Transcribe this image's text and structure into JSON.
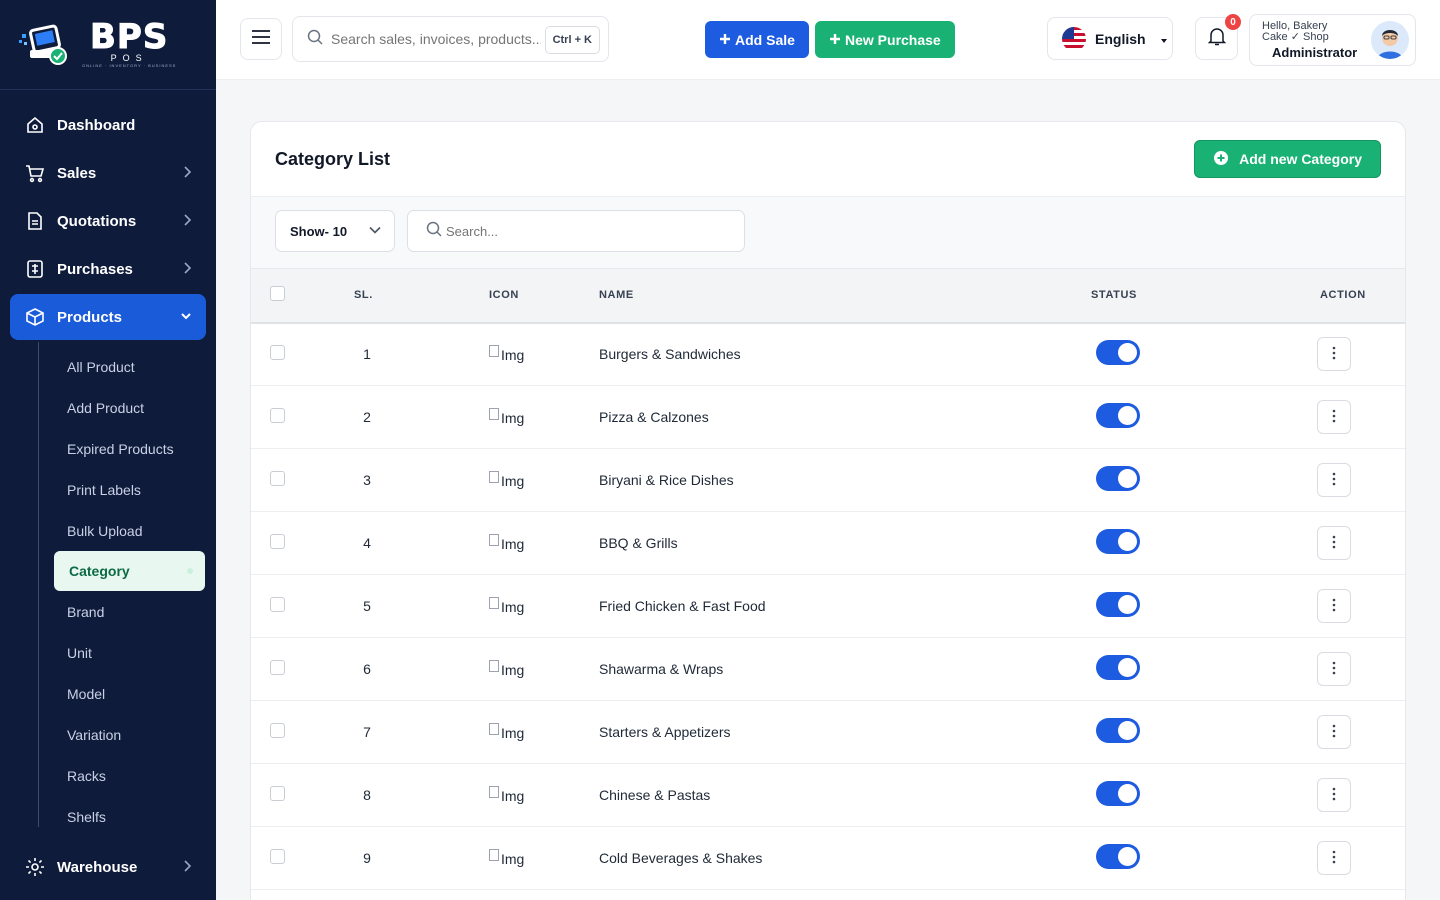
{
  "brand": {
    "name": "BPS",
    "sub": "POS",
    "tagline": "ONLINE · INVENTORY · BUSINESS"
  },
  "sidebar": {
    "items": [
      {
        "label": "Dashboard",
        "icon": "home-icon",
        "has_chevron": false
      },
      {
        "label": "Sales",
        "icon": "cart-icon",
        "has_chevron": true
      },
      {
        "label": "Quotations",
        "icon": "document-icon",
        "has_chevron": true
      },
      {
        "label": "Purchases",
        "icon": "receipt-icon",
        "has_chevron": true
      },
      {
        "label": "Products",
        "icon": "box-icon",
        "has_chevron": true,
        "active": true
      },
      {
        "label": "Warehouse",
        "icon": "gear-icon",
        "has_chevron": true
      }
    ],
    "products_sub": [
      "All Product",
      "Add Product",
      "Expired Products",
      "Print Labels",
      "Bulk Upload",
      "Category",
      "Brand",
      "Unit",
      "Model",
      "Variation",
      "Racks",
      "Shelfs"
    ],
    "active_sub": "Category"
  },
  "header": {
    "search_placeholder": "Search sales, invoices, products...",
    "shortcut": "Ctrl + K",
    "add_sale": "Add Sale",
    "new_purchase": "New Purchase",
    "language": "English",
    "notification_count": "0",
    "greeting": "Hello, Bakery Cake ✓ Shop",
    "role": "Administrator"
  },
  "page": {
    "title": "Category List",
    "add_button": "Add new Category",
    "show_select": "Show- 10",
    "search_placeholder": "Search..."
  },
  "table": {
    "columns": {
      "sl": "SL.",
      "icon": "ICON",
      "name": "NAME",
      "status": "STATUS",
      "action": "ACTION"
    },
    "rows": [
      {
        "sl": "1",
        "icon": "Img",
        "name": "Burgers & Sandwiches",
        "status": true
      },
      {
        "sl": "2",
        "icon": "Img",
        "name": "Pizza & Calzones",
        "status": true
      },
      {
        "sl": "3",
        "icon": "Img",
        "name": "Biryani & Rice Dishes",
        "status": true
      },
      {
        "sl": "4",
        "icon": "Img",
        "name": "BBQ & Grills",
        "status": true
      },
      {
        "sl": "5",
        "icon": "Img",
        "name": "Fried Chicken & Fast Food",
        "status": true
      },
      {
        "sl": "6",
        "icon": "Img",
        "name": "Shawarma & Wraps",
        "status": true
      },
      {
        "sl": "7",
        "icon": "Img",
        "name": "Starters & Appetizers",
        "status": true
      },
      {
        "sl": "8",
        "icon": "Img",
        "name": "Chinese & Pastas",
        "status": true
      },
      {
        "sl": "9",
        "icon": "Img",
        "name": "Cold Beverages & Shakes",
        "status": true
      }
    ]
  },
  "colors": {
    "sidebar_bg": "#0f1b3a",
    "primary": "#1d5be0",
    "success": "#19b274"
  }
}
